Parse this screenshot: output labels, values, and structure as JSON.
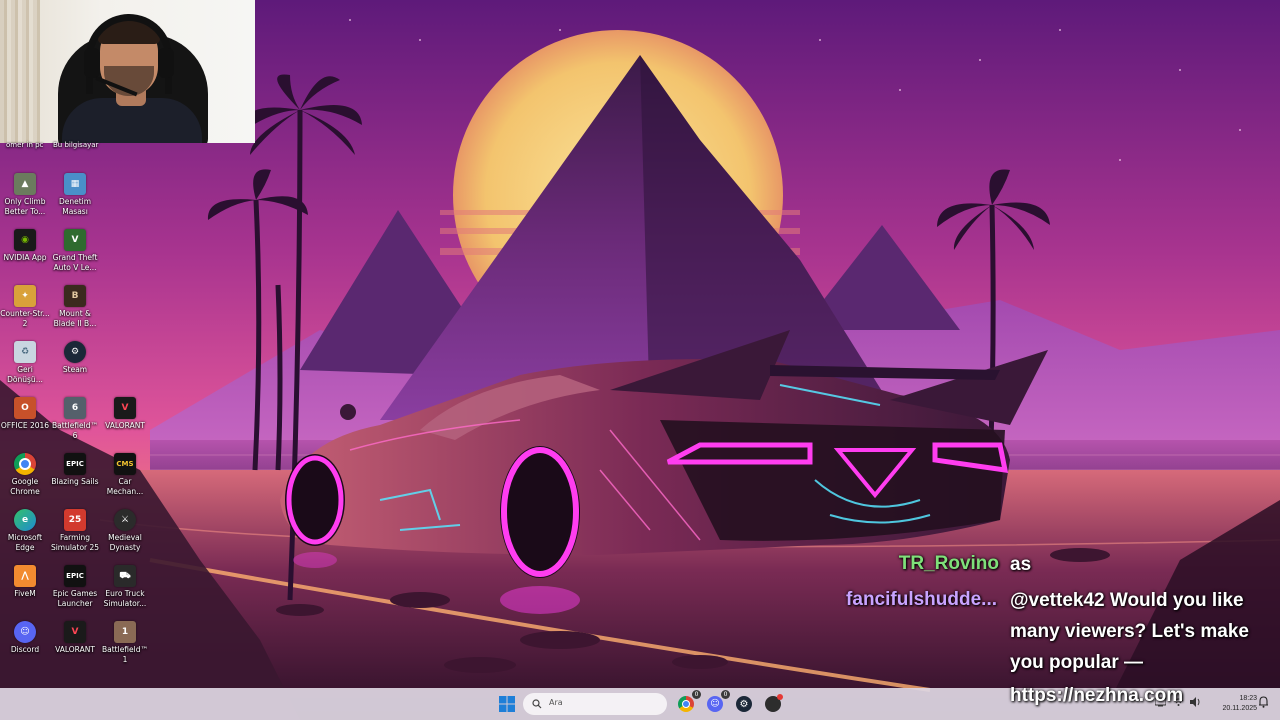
{
  "desktop": {
    "cut_labels": [
      "omer in pc",
      "Bu bilgisayar"
    ],
    "icons": [
      {
        "label": "Only Climb Better To...",
        "icon": "climb-game-icon",
        "color": "#6b7b5e"
      },
      {
        "label": "Denetim Masası",
        "icon": "control-panel-icon",
        "color": "#4a8fc9"
      },
      {
        "label": "NVIDIA App",
        "icon": "nvidia-icon",
        "color": "#1a1a1a"
      },
      {
        "label": "Grand Theft Auto V Le...",
        "icon": "gta-icon",
        "color": "#2f6b2f"
      },
      {
        "label": "Counter-Str... 2",
        "icon": "counter-strike-icon",
        "color": "#d9a13a"
      },
      {
        "label": "Mount & Blade II B...",
        "icon": "bannerlord-icon",
        "color": "#3b2a1e"
      },
      {
        "label": "Geri Dönüşü...",
        "icon": "recycle-bin-icon",
        "color": "#c9d6e0"
      },
      {
        "label": "Steam",
        "icon": "steam-icon",
        "color": "#1b2838"
      },
      {
        "label": "OFFICE 2016",
        "icon": "office-icon",
        "color": "#c7512a"
      },
      {
        "label": "Battlefield™ 6",
        "icon": "battlefield6-icon",
        "color": "#55606b"
      },
      {
        "label": "VALORANT",
        "icon": "valorant-icon",
        "color": "#1a1a1a"
      },
      {
        "label": "Google Chrome",
        "icon": "chrome-icon",
        "color": "#ffffff"
      },
      {
        "label": "Blazing Sails",
        "icon": "blazing-sails-icon",
        "color": "#111111"
      },
      {
        "label": "Car Mechan...",
        "icon": "car-mechanic-icon",
        "color": "#111111"
      },
      {
        "label": "Microsoft Edge",
        "icon": "edge-icon",
        "color": "#1f8ad1"
      },
      {
        "label": "Farming Simulator 25",
        "icon": "farming-sim-icon",
        "color": "#d23a2e"
      },
      {
        "label": "Medieval Dynasty",
        "icon": "medieval-dynasty-icon",
        "color": "#2b2b2b"
      },
      {
        "label": "FiveM",
        "icon": "fivem-icon",
        "color": "#f28b30"
      },
      {
        "label": "Epic Games Launcher",
        "icon": "epic-games-icon",
        "color": "#111111"
      },
      {
        "label": "Euro Truck Simulator...",
        "icon": "euro-truck-icon",
        "color": "#2a2a2a"
      },
      {
        "label": "Discord",
        "icon": "discord-icon",
        "color": "#5865f2"
      },
      {
        "label": "VALORANT",
        "icon": "valorant-icon",
        "color": "#1a1a1a"
      },
      {
        "label": "Battlefield™ 1",
        "icon": "battlefield1-icon",
        "color": "#8a6a55"
      }
    ]
  },
  "chat": {
    "users": [
      {
        "name": "TR_Rovino",
        "color": "#7fe07a"
      },
      {
        "name": "fancifulshudde...",
        "color": "#c9a3ff"
      }
    ],
    "message_lines": [
      "as",
      "@vettek42 Would you like",
      "many viewers? Let's make",
      "you popular —",
      "https://nezhna.com"
    ]
  },
  "taskbar": {
    "search_placeholder": "Ara",
    "badges": {
      "discord": "0",
      "chrome": "0"
    },
    "clock_time": "18:23",
    "clock_date": "20.11.2025",
    "tray_chevron": "^"
  },
  "colors": {
    "sky_top": "#7a1f88",
    "sky_mid": "#d9408a",
    "horizon": "#f08a5a",
    "sun": "#f3cf7a",
    "neon": "#ff3df0",
    "taskbar": "#ded6e2"
  }
}
